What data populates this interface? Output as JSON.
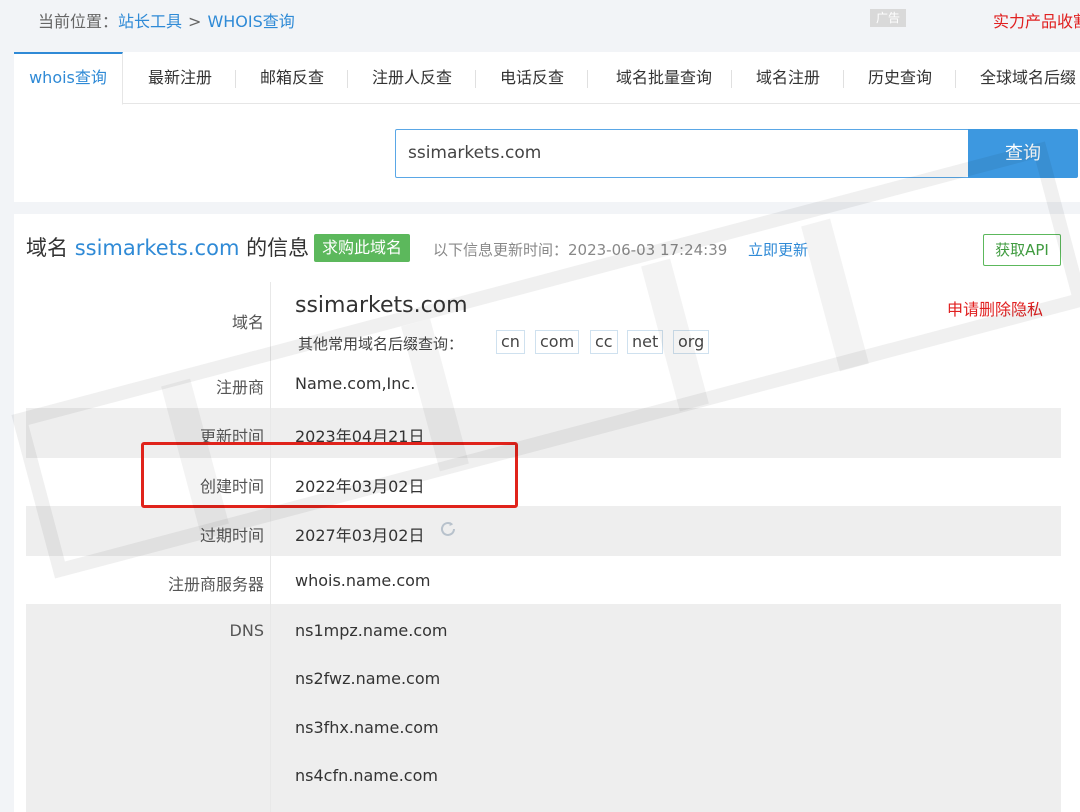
{
  "breadcrumb": {
    "prefix": "当前位置：",
    "home": "站长工具",
    "separator": ">",
    "current": "WHOIS查询"
  },
  "ad": {
    "badge": "广告",
    "promo_text": "实力产品收割"
  },
  "tabs": [
    {
      "label": "whois查询",
      "active": true
    },
    {
      "label": "最新注册"
    },
    {
      "label": "邮箱反查"
    },
    {
      "label": "注册人反查"
    },
    {
      "label": "电话反查"
    },
    {
      "label": "域名批量查询"
    },
    {
      "label": "域名注册"
    },
    {
      "label": "历史查询"
    },
    {
      "label": "全球域名后缀"
    }
  ],
  "search": {
    "value": "ssimarkets.com",
    "button": "查询"
  },
  "info": {
    "title_prefix": "域名",
    "title_domain": "ssimarkets.com",
    "title_suffix": "的信息",
    "buy_badge": "求购此域名",
    "updated_text": "以下信息更新时间：2023-06-03 17:24:39",
    "update_link": "立即更新",
    "api_button": "获取API"
  },
  "fields": {
    "domain_label": "域名",
    "domain_value": "ssimarkets.com",
    "delete_privacy": "申请删除隐私",
    "suffix_prompt": "其他常用域名后缀查询：",
    "suffixes": [
      "cn",
      "com",
      "cc",
      "net",
      "org"
    ],
    "registrar_label": "注册商",
    "registrar_value": "Name.com,Inc.",
    "updated_label": "更新时间",
    "updated_value": "2023年04月21日",
    "created_label": "创建时间",
    "created_value": "2022年03月02日",
    "expires_label": "过期时间",
    "expires_value": "2027年03月02日",
    "whois_server_label": "注册商服务器",
    "whois_server_value": "whois.name.com",
    "dns_label": "DNS",
    "dns": [
      "ns1mpz.name.com",
      "ns2fwz.name.com",
      "ns3fhx.name.com",
      "ns4cfn.name.com"
    ]
  },
  "colors": {
    "accent": "#2f8ad6",
    "green": "#5cb85c",
    "red": "#e02020"
  }
}
